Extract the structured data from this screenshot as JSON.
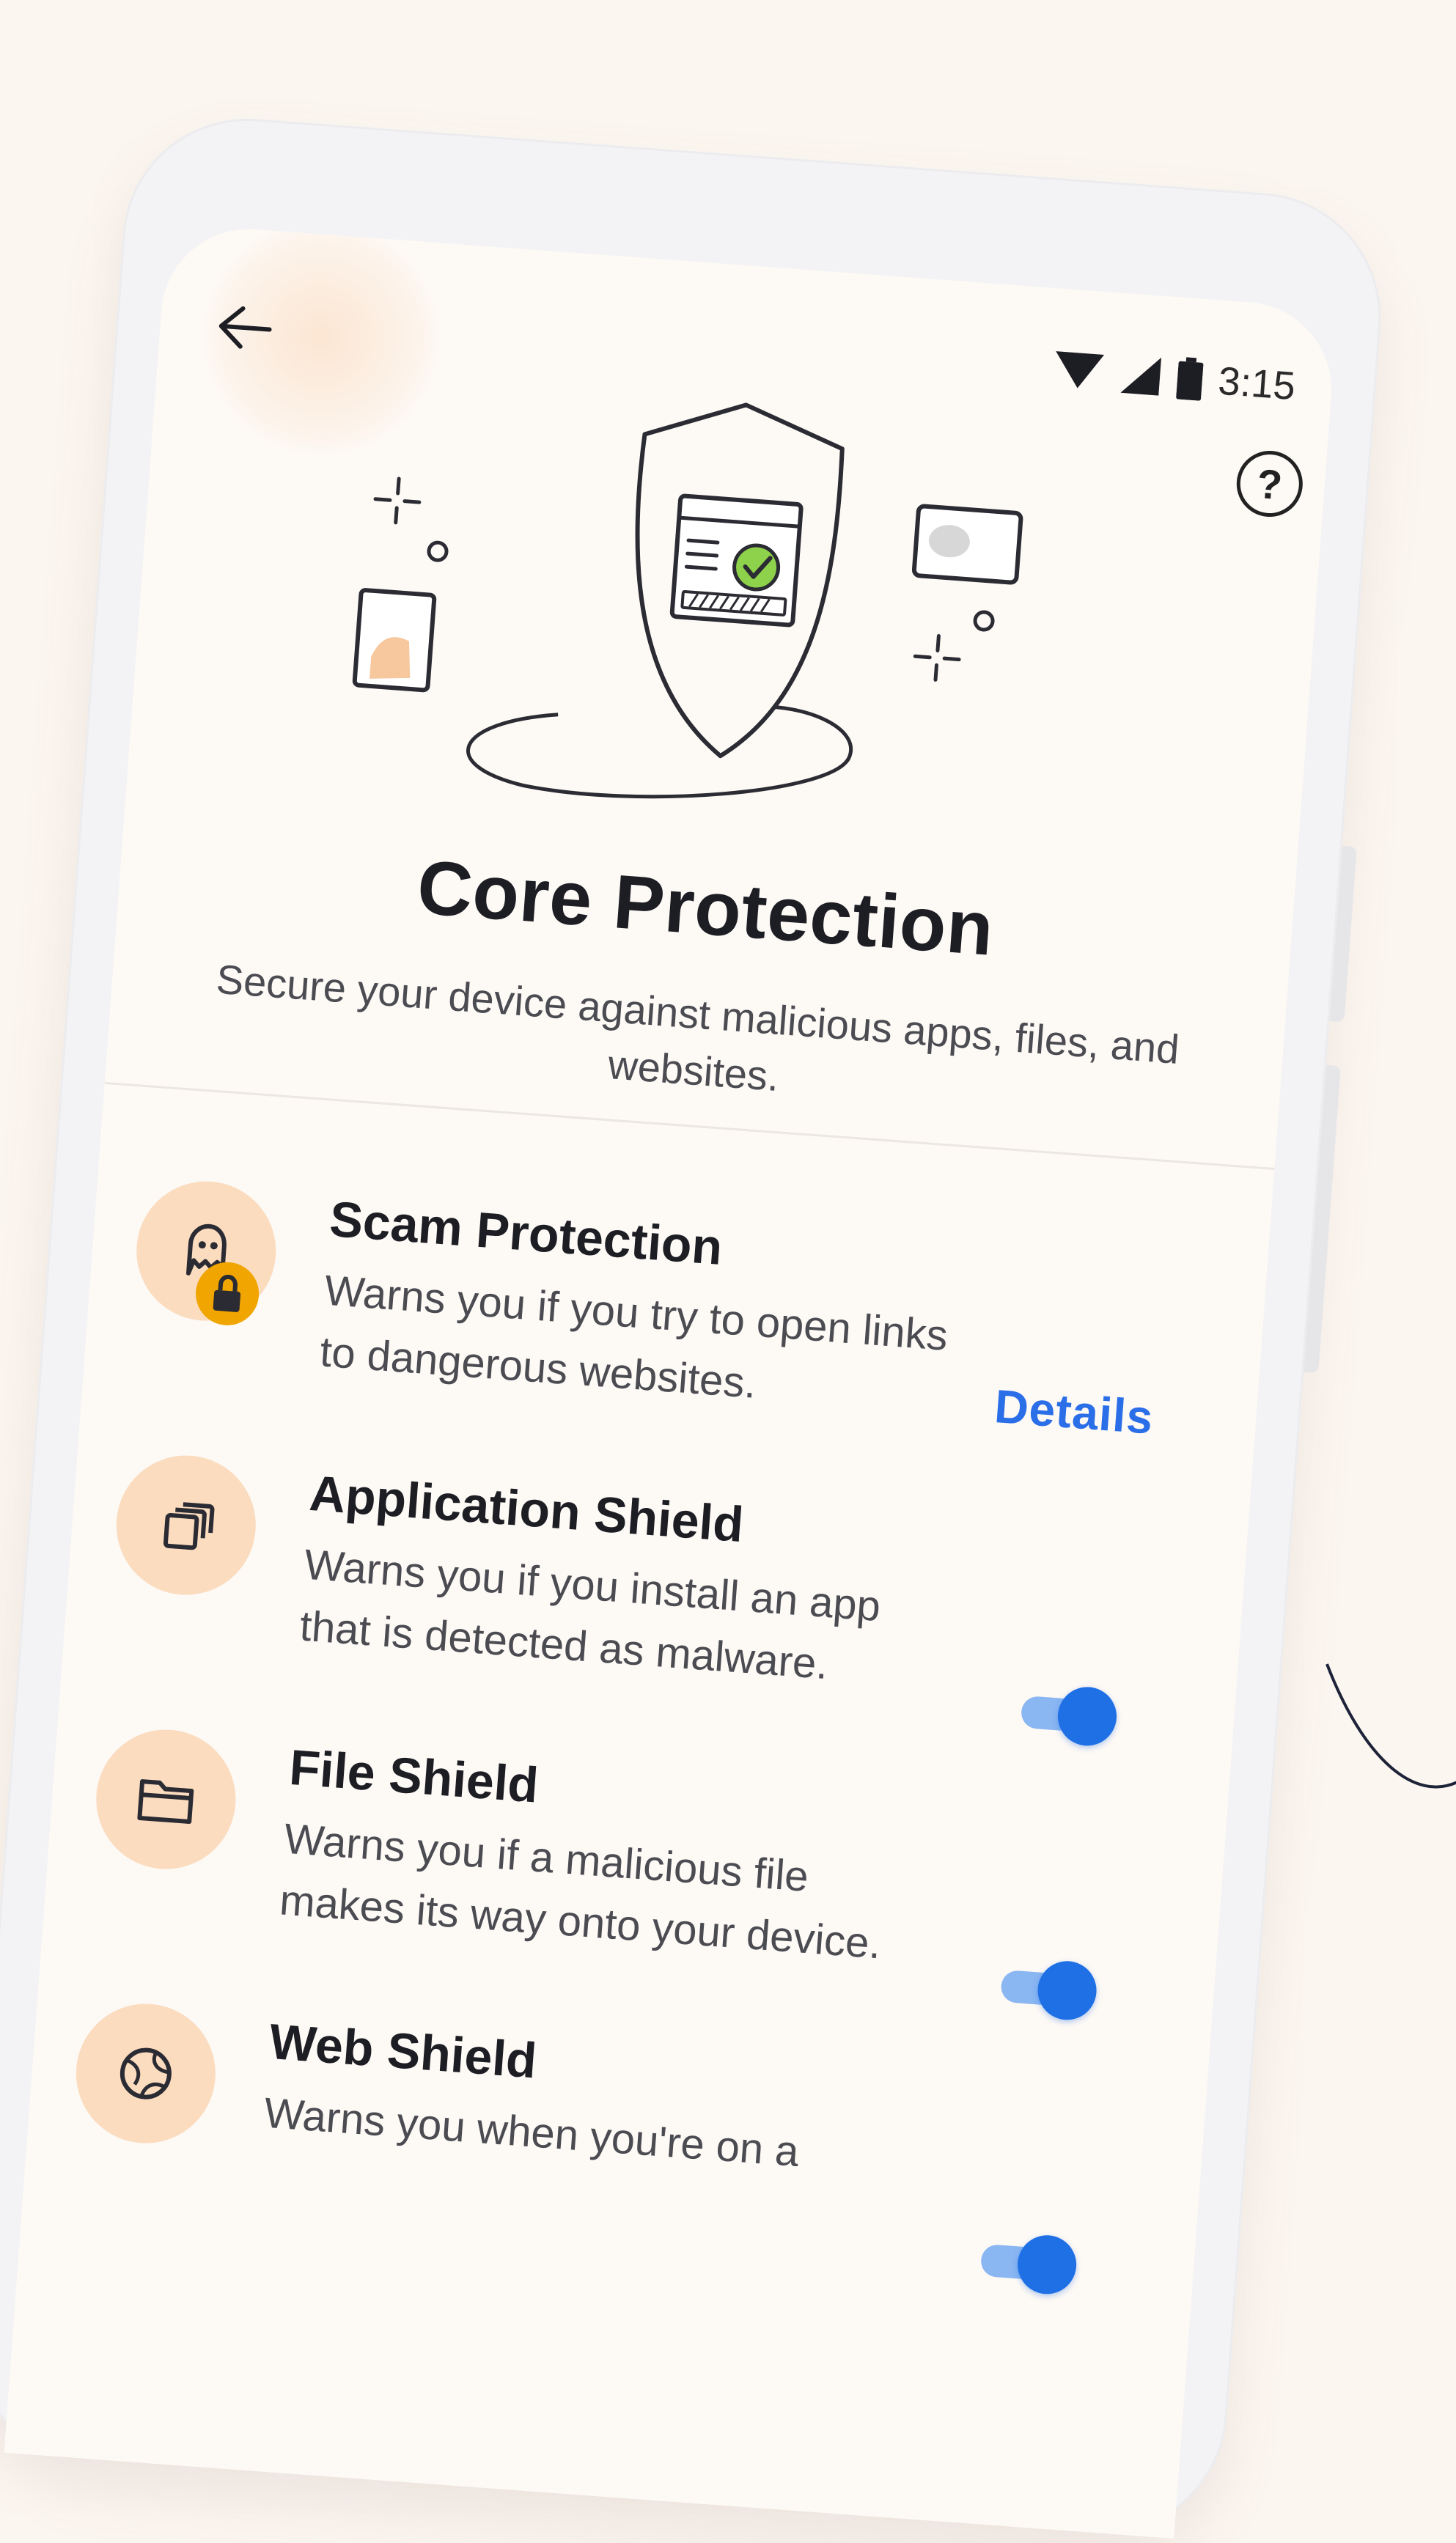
{
  "status_bar": {
    "time": "3:15"
  },
  "header": {
    "back_icon": "arrow-left-icon",
    "help_icon": "question-circle-icon",
    "help_glyph": "?"
  },
  "hero": {
    "illustration": "shield-with-checkmark-illustration"
  },
  "page": {
    "title": "Core Protection",
    "subtitle": "Secure your device against malicious apps, files, and websites."
  },
  "features": [
    {
      "title": "Scam Protection",
      "description": "Warns you if you try to open links to dangerous websites.",
      "icon": "ghost-icon",
      "badge_icon": "lock-icon",
      "action_label": "Details"
    },
    {
      "title": "Application Shield",
      "description": "Warns you if you install an app that is detected as malware.",
      "icon": "app-stack-icon",
      "enabled": true
    },
    {
      "title": "File Shield",
      "description": "Warns you if a malicious file makes its way onto your device.",
      "icon": "folder-icon",
      "enabled": true
    },
    {
      "title": "Web Shield",
      "description": "Warns you when you're on a",
      "icon": "globe-icon",
      "enabled": true
    }
  ],
  "colors": {
    "background": "#fcf6f0",
    "accent_blue": "#1f6fe5",
    "icon_circle": "#fbdcbf",
    "check_green": "#8ed14b",
    "lock_badge": "#f0a500"
  }
}
